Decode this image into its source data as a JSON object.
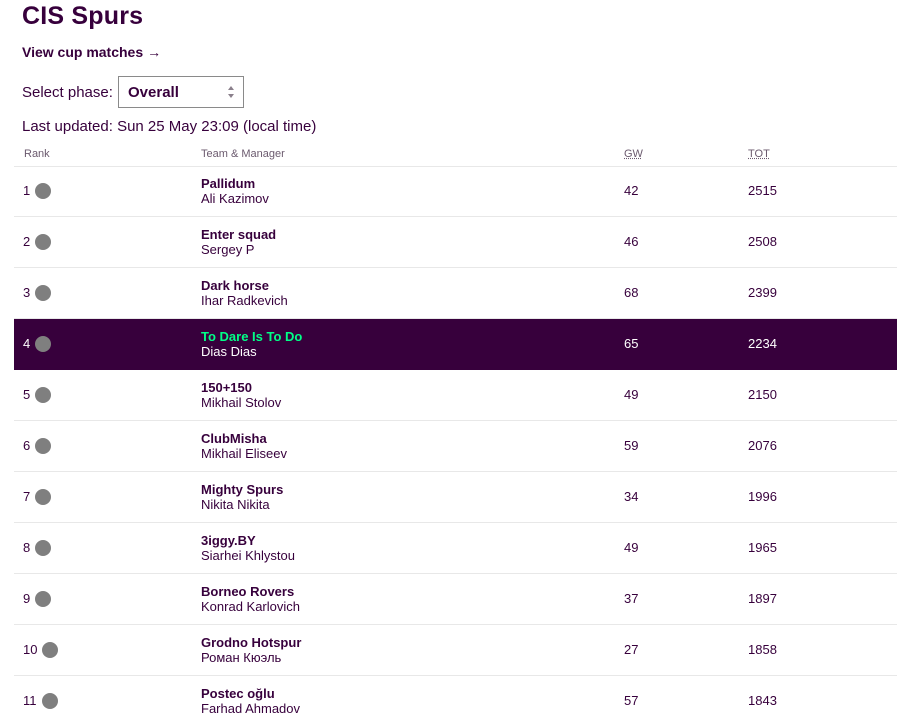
{
  "header": {
    "title": "CIS Spurs",
    "cup_link": "View cup matches",
    "cup_arrow": "→"
  },
  "phase": {
    "label": "Select phase:",
    "selected": "Overall"
  },
  "last_updated": "Last updated: Sun 25 May 23:09 (local time)",
  "table": {
    "columns": {
      "rank": "Rank",
      "team": "Team & Manager",
      "gw": "GW",
      "tot": "TOT"
    },
    "rows": [
      {
        "rank": "1",
        "team": "Pallidum",
        "manager": "Ali Kazimov",
        "gw": "42",
        "tot": "2515",
        "highlight": false
      },
      {
        "rank": "2",
        "team": "Enter squad",
        "manager": "Sergey P",
        "gw": "46",
        "tot": "2508",
        "highlight": false
      },
      {
        "rank": "3",
        "team": "Dark horse",
        "manager": "Ihar Radkevich",
        "gw": "68",
        "tot": "2399",
        "highlight": false
      },
      {
        "rank": "4",
        "team": "To Dare Is To Do",
        "manager": "Dias Dias",
        "gw": "65",
        "tot": "2234",
        "highlight": true
      },
      {
        "rank": "5",
        "team": "150+150",
        "manager": "Mikhail Stolov",
        "gw": "49",
        "tot": "2150",
        "highlight": false
      },
      {
        "rank": "6",
        "team": "ClubMisha",
        "manager": "Mikhail Eliseev",
        "gw": "59",
        "tot": "2076",
        "highlight": false
      },
      {
        "rank": "7",
        "team": "Mighty Spurs",
        "manager": "Nikita Nikita",
        "gw": "34",
        "tot": "1996",
        "highlight": false
      },
      {
        "rank": "8",
        "team": "3iggy.BY",
        "manager": "Siarhei Khlystou",
        "gw": "49",
        "tot": "1965",
        "highlight": false
      },
      {
        "rank": "9",
        "team": "Borneo Rovers",
        "manager": "Konrad Karlovich",
        "gw": "37",
        "tot": "1897",
        "highlight": false
      },
      {
        "rank": "10",
        "team": "Grodno Hotspur",
        "manager": "Роман Кюэль",
        "gw": "27",
        "tot": "1858",
        "highlight": false
      },
      {
        "rank": "11",
        "team": "Postec oğlu",
        "manager": "Farhad Ahmadov",
        "gw": "57",
        "tot": "1843",
        "highlight": false
      }
    ]
  },
  "colors": {
    "brand_purple": "#37003c",
    "highlight_team": "#00ff87",
    "movement_dot": "#7f7f7f"
  }
}
